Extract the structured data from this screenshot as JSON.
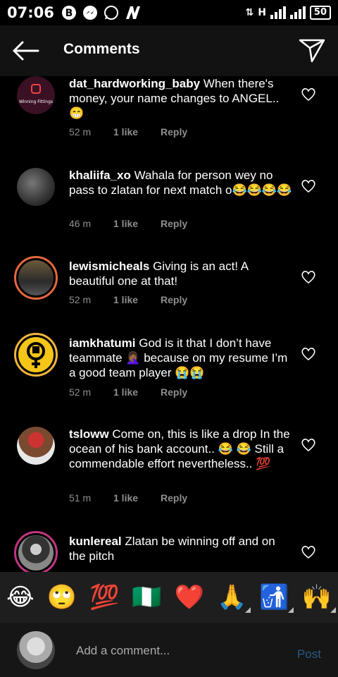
{
  "status": {
    "time": "07:06",
    "battery": "50",
    "signal": "H"
  },
  "header": {
    "title": "Comments"
  },
  "comments": [
    {
      "user": "dat_hardworking_baby",
      "text": "When there's money, your name changes to ANGEL.. 😁",
      "time": "52 m",
      "likes": "1 like",
      "reply": "Reply",
      "avatar_label": "Winning Fittings"
    },
    {
      "user": "khaliifa_xo",
      "text": "Wahala for person wey no pass to zlatan for next match o😂😂😂😂",
      "time": "46 m",
      "likes": "1 like",
      "reply": "Reply"
    },
    {
      "user": "lewismicheals",
      "text": "Giving is an act! A beautiful one at that!",
      "time": "52 m",
      "likes": "1 like",
      "reply": "Reply"
    },
    {
      "user": "iamkhatumi",
      "text": "God is it that I don’t have teammate 🤦🏾‍♀️ because on my resume I’m a good team player 😭😭",
      "time": "52 m",
      "likes": "1 like",
      "reply": "Reply"
    },
    {
      "user": "tsloww",
      "text": "Come on, this is like a drop In the ocean of his bank account.. 😂 😂 Still a commendable effort nevertheless.. 💯",
      "time": "51 m",
      "likes": "1 like",
      "reply": "Reply"
    },
    {
      "user": "kunlereal",
      "text": "Zlatan be winning off and on the pitch"
    }
  ],
  "emoji_bar": [
    "😂",
    "🙄",
    "💯",
    "🇳🇬",
    "❤️",
    "🙏",
    "🚮",
    "🙌"
  ],
  "composer": {
    "placeholder": "Add a comment...",
    "post_label": "Post"
  }
}
